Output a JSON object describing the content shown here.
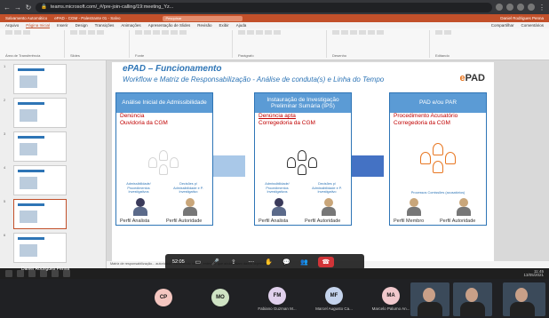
{
  "browser": {
    "url": "teams.microsoft.com/_#/pre-join-calling/19:meeting_Yz...",
    "extensions": [
      "extension-icon",
      "extension-icon",
      "extension-icon",
      "extension-icon"
    ]
  },
  "ppt": {
    "title_left": "Salvamento Automático",
    "title_center": "ePAD - CGM - Palestrante 01 - Salvo",
    "search": "Pesquisar",
    "user": "Daniel Rodrigues Penna",
    "tabs": [
      "Arquivo",
      "Página Inicial",
      "Inserir",
      "Design",
      "Transições",
      "Animações",
      "Apresentação de Slides",
      "Revisão",
      "Exibir",
      "Ajuda"
    ],
    "active_tab": "Página Inicial",
    "share": "Compartilhar",
    "comments": "Comentários",
    "ribbon_groups": [
      "Área de Transferência",
      "Slides",
      "Fonte",
      "Parágrafo",
      "Desenho",
      "Editando"
    ],
    "slide_numbers": [
      "1",
      "2",
      "3",
      "4",
      "5",
      "6",
      "7"
    ]
  },
  "slide": {
    "title": "ePAD – Funcionamento",
    "subtitle": "Workflow e Matriz de Responsabilização - Análise de conduta(s) e Linha do Tempo",
    "logo_e": "e",
    "logo_pad": "PAD",
    "columns": [
      {
        "header": "Análise Inicial de Admissibilidade",
        "line1": "Denúncia",
        "line2": "Ouvidoria da CGM",
        "mini_left": "Admissibilidade/ Procedimentos Investigativos",
        "mini_right": "Decisões p/ Admissibilidade e P. Investigativo",
        "foot_left": "Perfil Analista",
        "foot_right": "Perfil Autoridade"
      },
      {
        "header": "Instauração de Investigação Preliminar Sumária (IPS)",
        "line1": "Denúncia apta",
        "line2": "Corregedoria da CGM",
        "mini_left": "Admissibilidade/ Procedimentos Investigativos",
        "mini_right": "Decisões p/ Admissibilidade e P. Investigativo",
        "foot_left": "Perfil Analista",
        "foot_right": "Perfil Autoridade"
      },
      {
        "header": "PAD e/ou PAR",
        "line1": "Procedimento Acusatório",
        "line2": "Corregedoria da CGM",
        "mini_left": "Processos Comissões (acusatórios)",
        "mini_right": "",
        "foot_left": "Perfil Membro",
        "foot_right": "Perfil Autoridade"
      }
    ],
    "notes": "Matriz de responsabilização... autoridade, escolhendo na IST, entender que ainda faltam dados objetivos"
  },
  "meeting": {
    "timer": "52:05",
    "presenter": "Daniel Rodrigues Penna",
    "participants": [
      {
        "initials": "CP",
        "name": "",
        "color": "#f4c6c0"
      },
      {
        "initials": "MO",
        "name": "",
        "color": "#cfe3c4"
      },
      {
        "initials": "FM",
        "name": "Fabiano Guzman M...",
        "color": "#e0d0ec"
      },
      {
        "initials": "MF",
        "name": "Marcel Augusto Ca...",
        "color": "#c4d3ec"
      },
      {
        "initials": "MA",
        "name": "Marcelo Palumo An...",
        "color": "#f0c8cc"
      }
    ]
  },
  "taskbar": {
    "clock": "11:45",
    "date": "13/05/2021"
  }
}
